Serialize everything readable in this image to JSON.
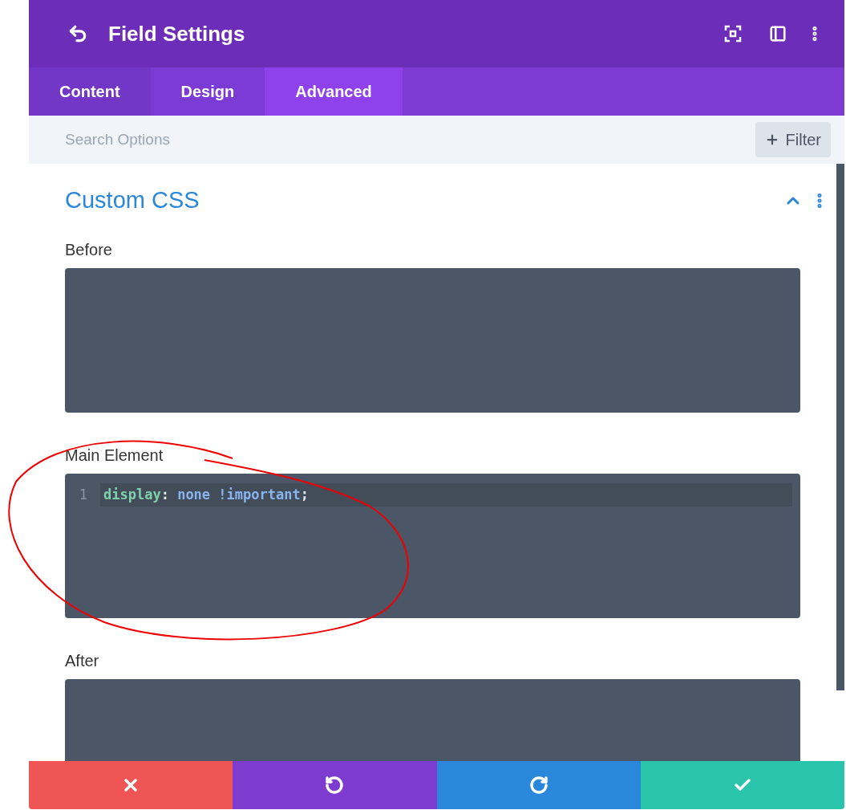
{
  "header": {
    "title": "Field Settings"
  },
  "tabs": [
    {
      "label": "Content",
      "selected": false
    },
    {
      "label": "Design",
      "selected": false
    },
    {
      "label": "Advanced",
      "selected": true
    }
  ],
  "search": {
    "placeholder": "Search Options"
  },
  "filter_button": {
    "label": "Filter"
  },
  "section": {
    "title": "Custom CSS",
    "expanded": true
  },
  "fields": [
    {
      "label": "Before"
    },
    {
      "label": "Main Element",
      "lines": [
        {
          "number": "1",
          "active": true,
          "tokens": [
            {
              "kind": "property",
              "text": "display"
            },
            {
              "kind": "punct",
              "text": ":"
            },
            {
              "kind": "value",
              "text": " none !important"
            },
            {
              "kind": "punct",
              "text": ";"
            }
          ]
        }
      ]
    },
    {
      "label": "After"
    }
  ],
  "footer_buttons": [
    {
      "kind": "cancel"
    },
    {
      "kind": "undo"
    },
    {
      "kind": "redo"
    },
    {
      "kind": "save"
    }
  ]
}
